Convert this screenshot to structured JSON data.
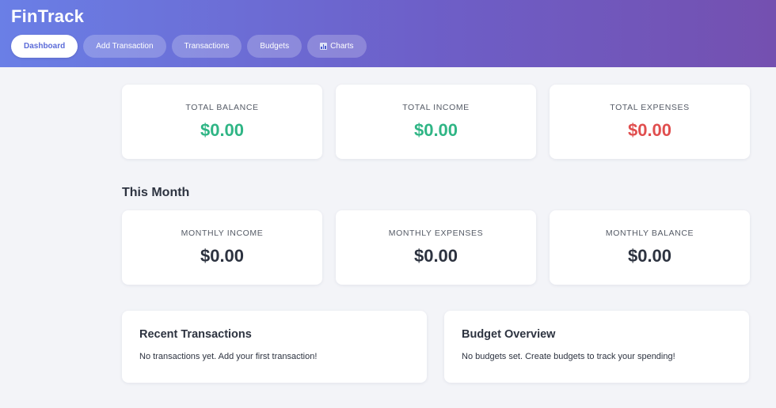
{
  "app": {
    "title": "FinTrack"
  },
  "nav": {
    "items": [
      {
        "label": "Dashboard",
        "active": true
      },
      {
        "label": "Add Transaction",
        "active": false
      },
      {
        "label": "Transactions",
        "active": false
      },
      {
        "label": "Budgets",
        "active": false
      },
      {
        "label": "Charts",
        "active": false,
        "icon": "bar-chart-icon"
      }
    ]
  },
  "summary": {
    "total_balance": {
      "label": "TOTAL BALANCE",
      "value": "$0.00",
      "color": "#2fb585"
    },
    "total_income": {
      "label": "TOTAL INCOME",
      "value": "$0.00",
      "color": "#2fb585"
    },
    "total_expenses": {
      "label": "TOTAL EXPENSES",
      "value": "$0.00",
      "color": "#e04e4e"
    }
  },
  "this_month": {
    "title": "This Month",
    "monthly_income": {
      "label": "MONTHLY INCOME",
      "value": "$0.00"
    },
    "monthly_expenses": {
      "label": "MONTHLY EXPENSES",
      "value": "$0.00"
    },
    "monthly_balance": {
      "label": "MONTHLY BALANCE",
      "value": "$0.00"
    }
  },
  "recent_transactions": {
    "title": "Recent Transactions",
    "empty_text": "No transactions yet. Add your first transaction!"
  },
  "budget_overview": {
    "title": "Budget Overview",
    "empty_text": "No budgets set. Create budgets to track your spending!"
  },
  "theme": {
    "header_gradient_start": "#6a7fe6",
    "header_gradient_end": "#7450b0",
    "accent": "#5b6bd8",
    "positive": "#2fb585",
    "negative": "#e04e4e"
  }
}
